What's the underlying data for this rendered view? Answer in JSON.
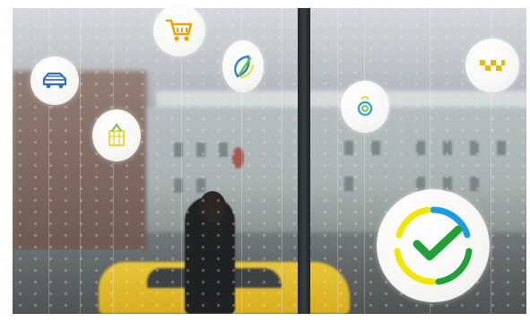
{
  "scene": {
    "description_icons": [
      "cart-icon",
      "car-icon",
      "leaf-icon",
      "basket-icon",
      "apple-icon",
      "taxi-icon",
      "sberbank-logo-icon"
    ],
    "colors": {
      "cart": "#e9a400",
      "car": "#2e6fb6",
      "leaf_blue": "#2a7fd4",
      "leaf_green": "#6cc34a",
      "basket": "#ead84a",
      "apple": "#31a7d9",
      "taxi": "#e9b700",
      "logo_green": "#21a038",
      "logo_yellow": "#f2e500",
      "logo_blue": "#1a9be2"
    }
  }
}
